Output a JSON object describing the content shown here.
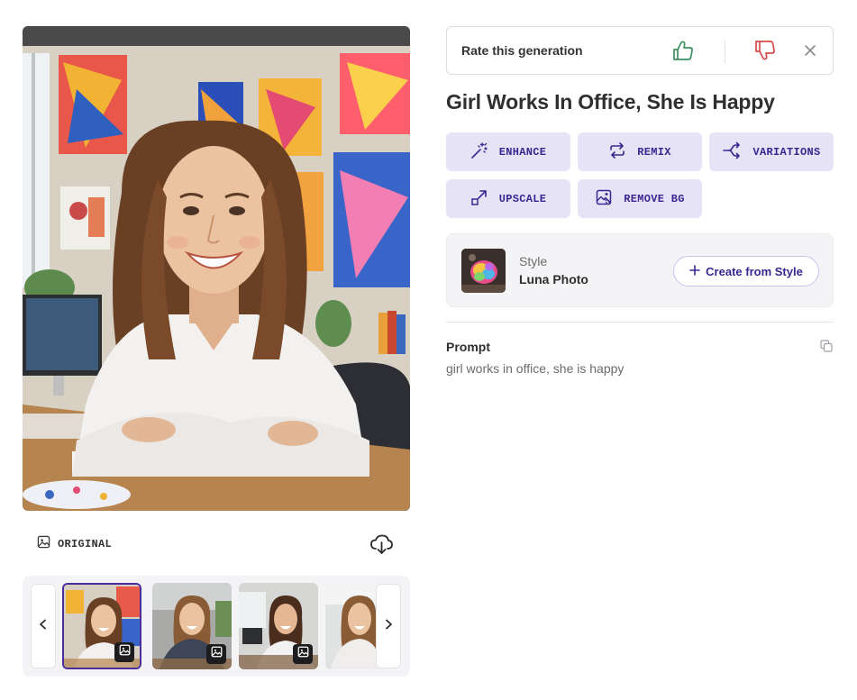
{
  "image_panel": {
    "original_label": "ORIGINAL",
    "icons": {
      "original": "image-icon",
      "download": "cloud-download-icon"
    }
  },
  "thumbnails": {
    "items": [
      {
        "label": "thumbnail-1",
        "selected": true
      },
      {
        "label": "thumbnail-2",
        "selected": false
      },
      {
        "label": "thumbnail-3",
        "selected": false
      },
      {
        "label": "thumbnail-4",
        "selected": false
      }
    ],
    "icons": {
      "prev": "chevron-left-icon",
      "next": "chevron-right-icon",
      "badge": "image-icon"
    }
  },
  "rating": {
    "label": "Rate this generation",
    "icons": {
      "up": "thumbs-up-icon",
      "down": "thumbs-down-icon",
      "close": "close-icon"
    },
    "colors": {
      "up": "#3f8f5f",
      "down": "#d6494a"
    }
  },
  "title": "Girl Works In Office, She Is Happy",
  "actions": {
    "enhance": "ENHANCE",
    "remix": "REMIX",
    "variations": "VARIATIONS",
    "upscale": "UPSCALE",
    "remove_bg": "REMOVE BG"
  },
  "style": {
    "caption": "Style",
    "name": "Luna Photo",
    "create_button": "Create from Style"
  },
  "prompt": {
    "heading": "Prompt",
    "text": "girl works in office, she is happy"
  },
  "colors": {
    "accent": "#3b2690",
    "button_bg": "#e6e3f7",
    "selected_border": "#4a2d9b"
  }
}
